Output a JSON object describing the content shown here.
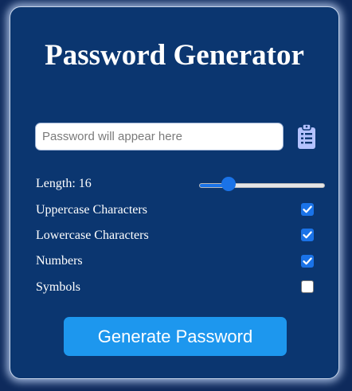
{
  "app": {
    "title": "Password Generator"
  },
  "password": {
    "value": "",
    "placeholder": "Password will appear here",
    "copy_icon": "clipboard-icon"
  },
  "length": {
    "label": "Length: ",
    "value": "16",
    "min": 4,
    "max": 64,
    "current": 16
  },
  "options": [
    {
      "label": "Uppercase Characters",
      "checked": true
    },
    {
      "label": "Lowercase Characters",
      "checked": true
    },
    {
      "label": "Numbers",
      "checked": true
    },
    {
      "label": "Symbols",
      "checked": false
    }
  ],
  "generate": {
    "label": "Generate Password"
  },
  "colors": {
    "panel": "#0b3670",
    "accent": "#1a73e8",
    "button": "#1d97ee",
    "icon": "#b4c2ff"
  }
}
